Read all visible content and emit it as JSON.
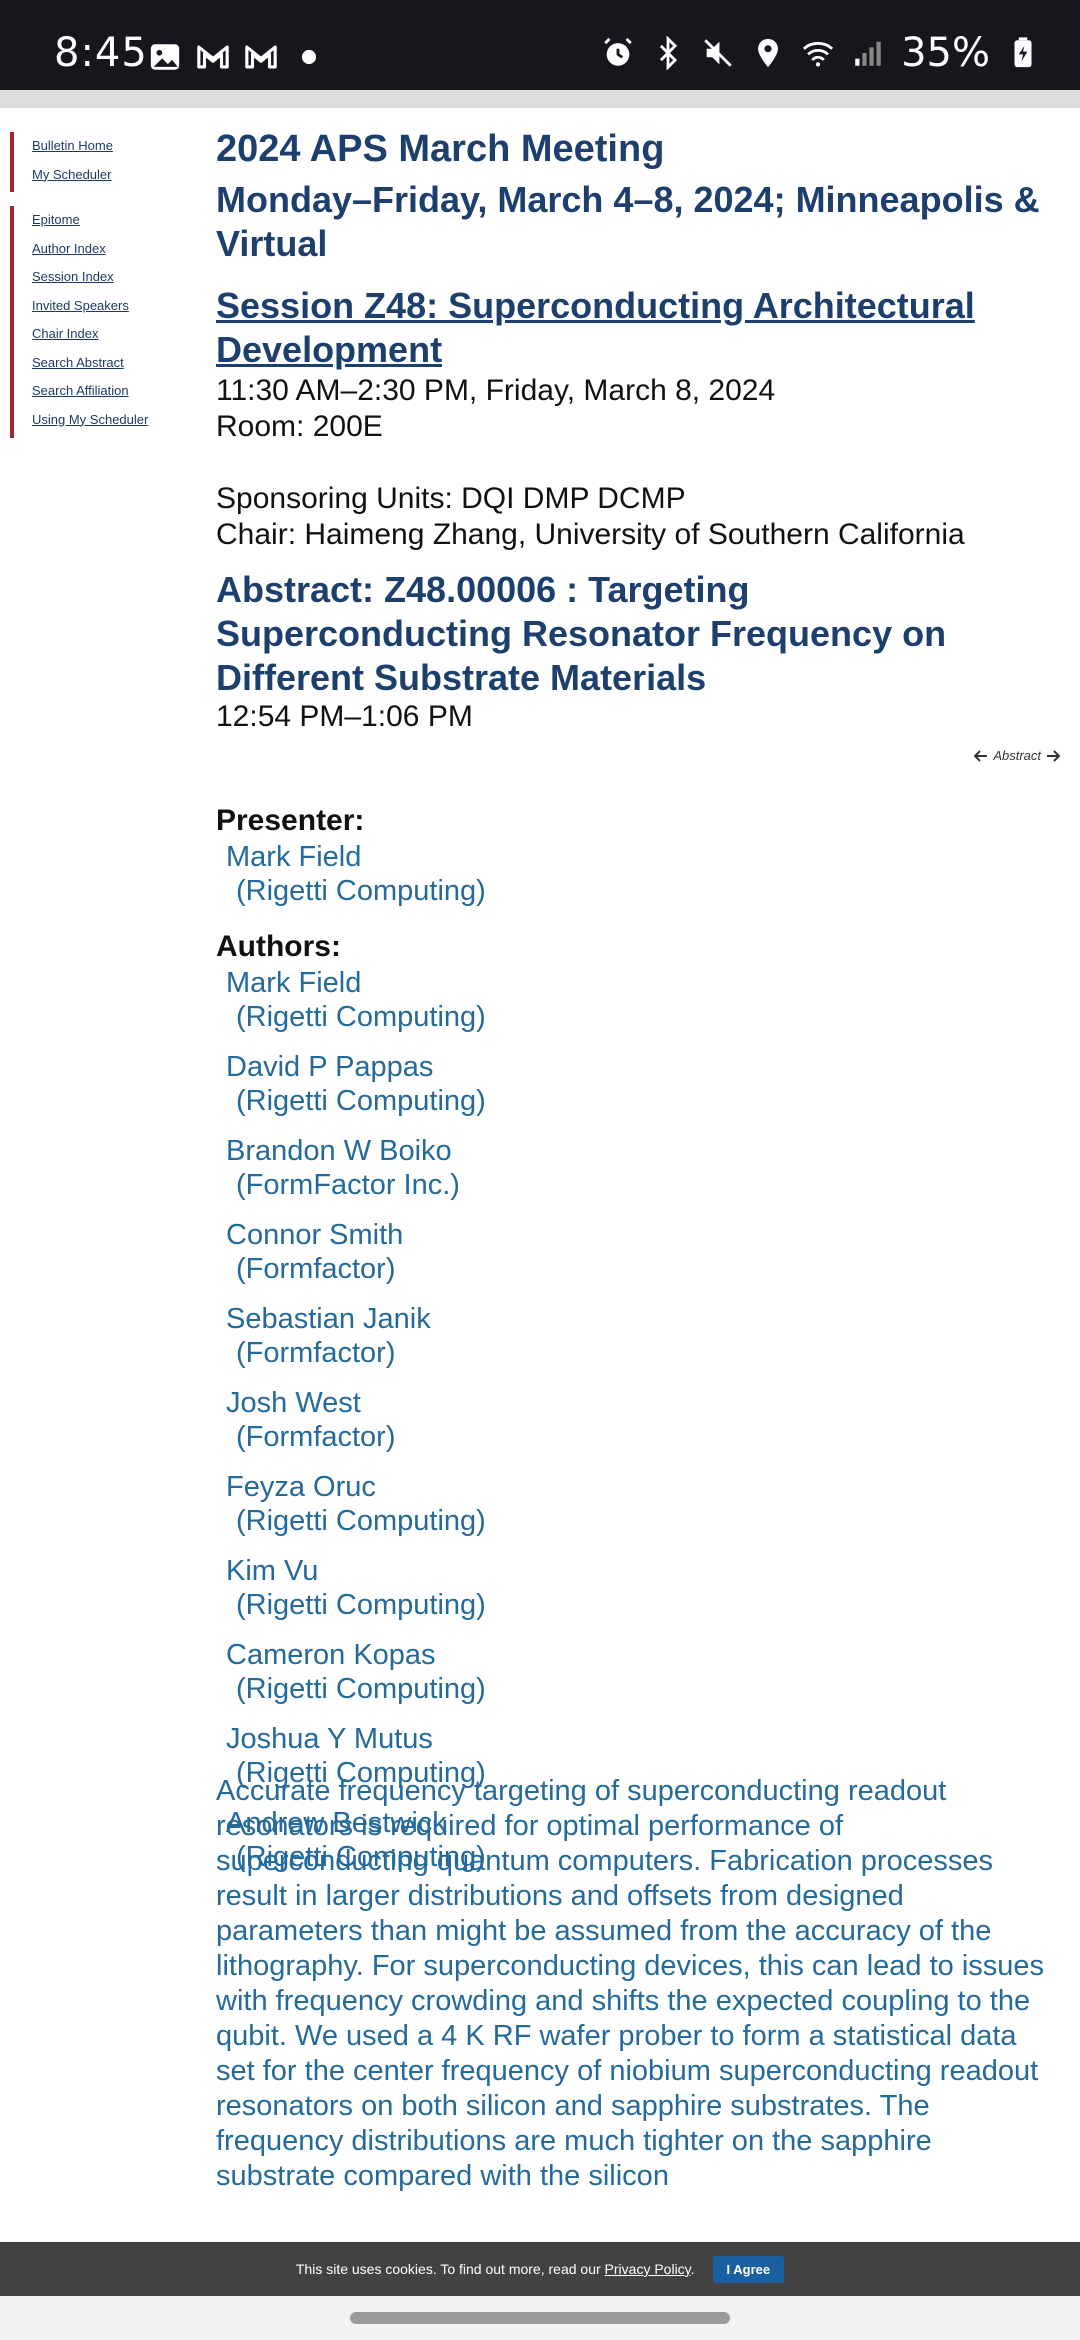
{
  "status_bar": {
    "time": "8:45",
    "battery": "35%",
    "icons_left": [
      "image-icon",
      "gmail-icon",
      "gmail-icon",
      "dot-icon"
    ],
    "icons_right": [
      "alarm-icon",
      "bluetooth-icon",
      "mute-icon",
      "location-icon",
      "wifi-icon",
      "signal-icon",
      "battery-icon"
    ]
  },
  "sidebar": {
    "group1": [
      {
        "label": "Bulletin Home"
      },
      {
        "label": "My Scheduler"
      }
    ],
    "group2": [
      {
        "label": "Epitome"
      },
      {
        "label": "Author Index"
      },
      {
        "label": "Session Index"
      },
      {
        "label": "Invited Speakers"
      },
      {
        "label": "Chair Index"
      },
      {
        "label": "Search Abstract"
      },
      {
        "label": "Search Affiliation"
      },
      {
        "label": "Using My Scheduler"
      }
    ],
    "accent_color": "#a0282a"
  },
  "meeting": {
    "title": "2024 APS March Meeting",
    "dates": "Monday–Friday, March 4–8, 2024; Minneapolis & Virtual"
  },
  "session": {
    "title": "Session Z48: Superconducting Architectural Development",
    "time": "11:30 AM–2:30 PM, Friday, March 8, 2024",
    "room": "Room: 200E",
    "sponsoring_units": "Sponsoring Units: DQI DMP DCMP",
    "chair": "Chair: Haimeng Zhang, University of Southern California"
  },
  "abstract": {
    "title": "Abstract: Z48.00006 : Targeting Superconducting Resonator Frequency on Different Substrate Materials",
    "time": "12:54 PM–1:06 PM",
    "nav_label": "Abstract",
    "body": "Accurate frequency targeting of superconducting readout resonators is required for optimal performance of superconducting quantum computers. Fabrication processes result in larger distributions and offsets from designed parameters than might be assumed from the accuracy of the lithography. For superconducting devices, this can lead to issues with frequency crowding and shifts the expected coupling to the qubit. We used a 4 K RF wafer prober to form a statistical data set for the center frequency of niobium superconducting readout resonators on both silicon and sapphire substrates. The frequency distributions are much tighter on the sapphire substrate compared with the silicon"
  },
  "presenter": {
    "label": "Presenter:",
    "name": "Mark Field",
    "affiliation": "(Rigetti Computing)"
  },
  "authors": {
    "label": "Authors:",
    "list": [
      {
        "name": "Mark Field",
        "affiliation": "(Rigetti Computing)"
      },
      {
        "name": "David P Pappas",
        "affiliation": "(Rigetti Computing)"
      },
      {
        "name": "Brandon W Boiko",
        "affiliation": "(FormFactor Inc.)"
      },
      {
        "name": "Connor Smith",
        "affiliation": "(Formfactor)"
      },
      {
        "name": "Sebastian Janik",
        "affiliation": "(Formfactor)"
      },
      {
        "name": "Josh West",
        "affiliation": "(Formfactor)"
      },
      {
        "name": "Feyza Oruc",
        "affiliation": "(Rigetti Computing)"
      },
      {
        "name": "Kim Vu",
        "affiliation": "(Rigetti Computing)"
      },
      {
        "name": "Cameron Kopas",
        "affiliation": "(Rigetti Computing)"
      },
      {
        "name": "Joshua Y Mutus",
        "affiliation": "(Rigetti Computing)"
      },
      {
        "name": "Andrew Bestwick",
        "affiliation": "(Rigetti Computing)"
      }
    ]
  },
  "cookie_banner": {
    "text": "This site uses cookies. To find out more, read our ",
    "link": "Privacy Policy",
    "period": ".",
    "button": "I Agree"
  },
  "colors": {
    "heading": "#1d3f6e",
    "link": "#246a9a",
    "status_bar_bg": "#16171c",
    "cookie_button": "#1a5fa0"
  }
}
